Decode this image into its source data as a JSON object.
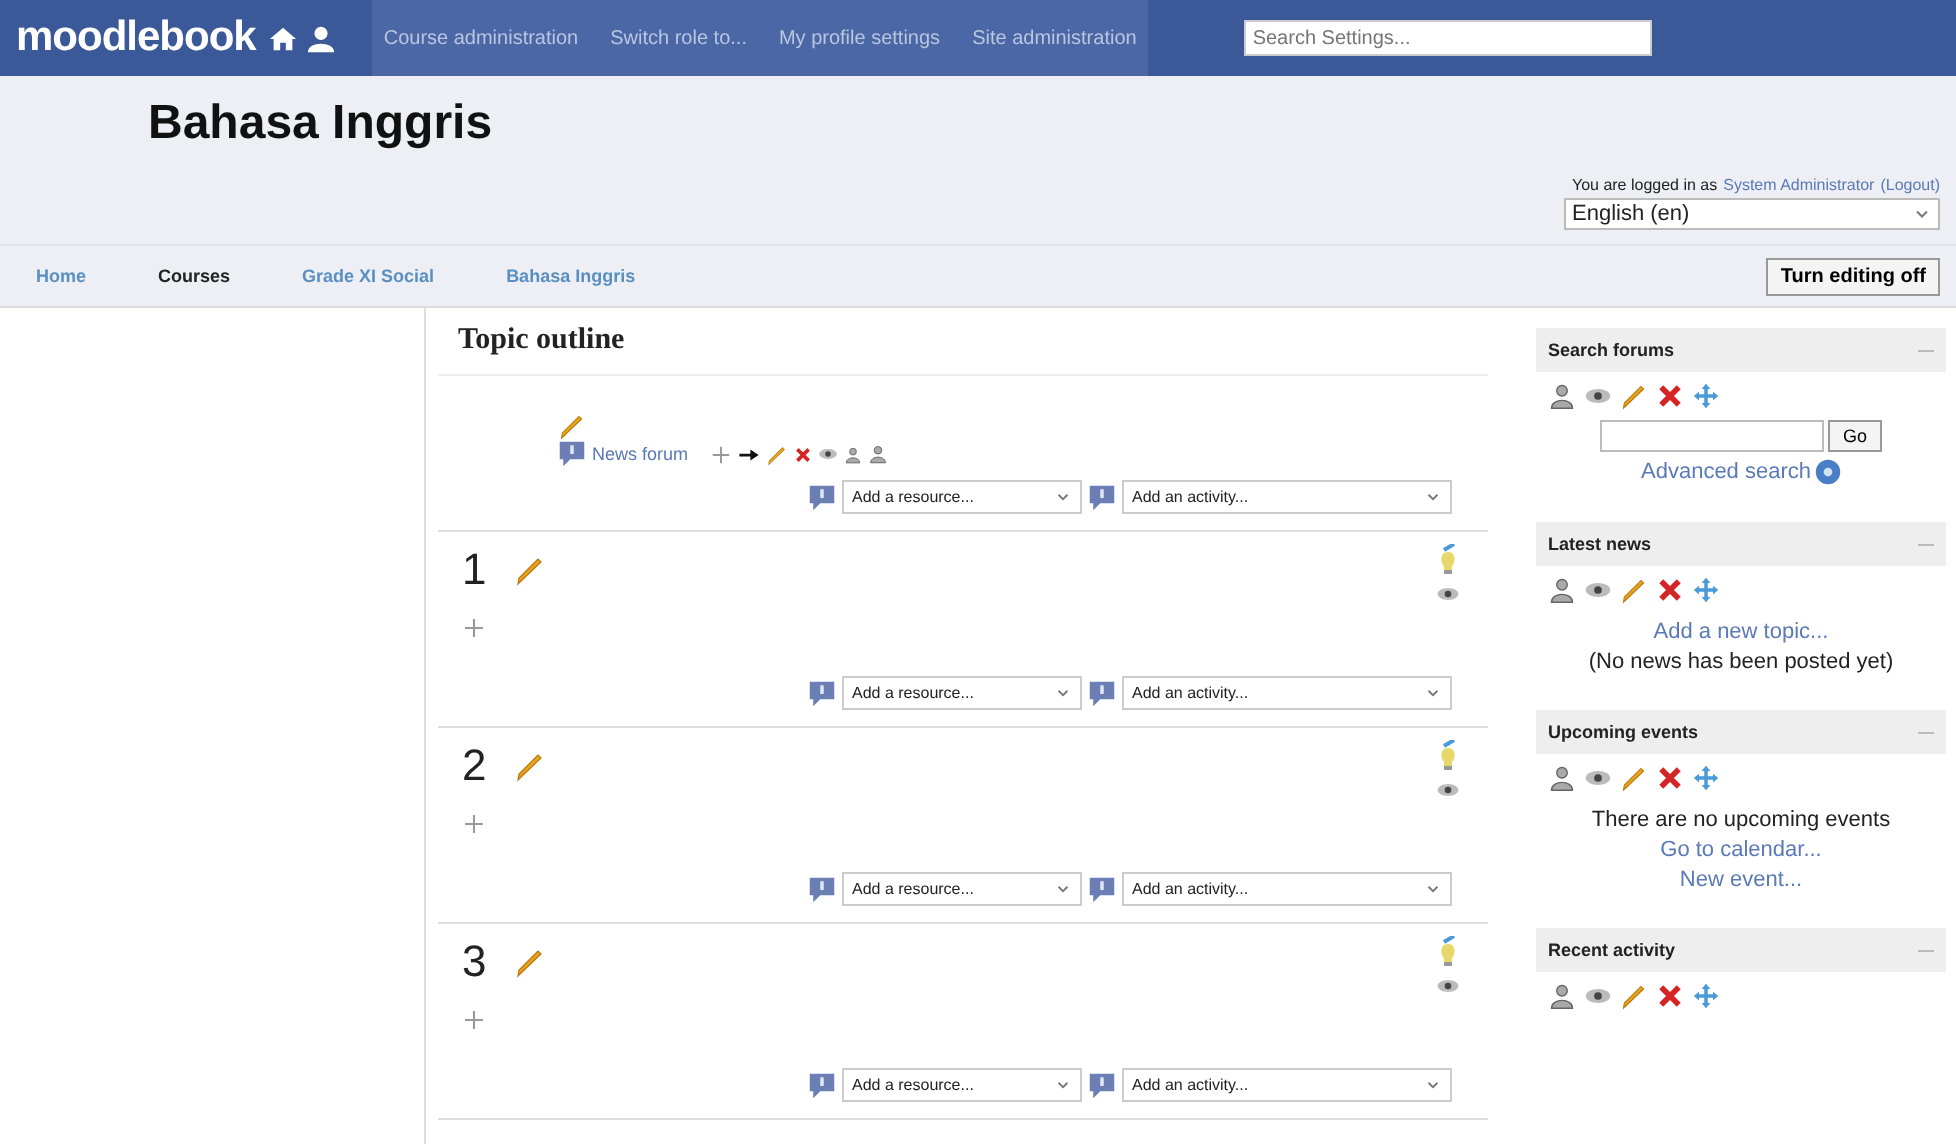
{
  "header": {
    "logo": "moodlebook",
    "menu": [
      "Course administration",
      "Switch role to...",
      "My profile settings",
      "Site administration"
    ],
    "search": {
      "placeholder": "Search Settings..."
    }
  },
  "page": {
    "title": "Bahasa Inggris",
    "login": {
      "text": "You are logged in as",
      "user": "System Administrator",
      "logout": "(Logout)"
    },
    "language": "English (en)",
    "breadcrumbs": [
      {
        "label": "Home",
        "link": true
      },
      {
        "label": "Courses",
        "link": false
      },
      {
        "label": "Grade XI Social",
        "link": true
      },
      {
        "label": "Bahasa Inggris",
        "link": true
      }
    ],
    "edit_button": "Turn editing off"
  },
  "topic_outline": {
    "title": "Topic outline",
    "intro": {
      "forum": "News forum",
      "add_resource": "Add a resource...",
      "add_activity": "Add an activity..."
    },
    "sections": [
      {
        "number": "1",
        "add_resource": "Add a resource...",
        "add_activity": "Add an activity..."
      },
      {
        "number": "2",
        "add_resource": "Add a resource...",
        "add_activity": "Add an activity..."
      },
      {
        "number": "3",
        "add_resource": "Add a resource...",
        "add_activity": "Add an activity..."
      }
    ]
  },
  "blocks": [
    {
      "title": "Search forums",
      "items": [
        {
          "kind": "search",
          "button": "Go"
        },
        {
          "kind": "help_link",
          "text": "Advanced search"
        }
      ]
    },
    {
      "title": "Latest news",
      "items": [
        {
          "kind": "link",
          "text": "Add a new topic..."
        },
        {
          "kind": "text",
          "text": "(No news has been posted yet)"
        }
      ]
    },
    {
      "title": "Upcoming events",
      "items": [
        {
          "kind": "text",
          "text": "There are no upcoming events"
        },
        {
          "kind": "link",
          "text": "Go to calendar..."
        },
        {
          "kind": "link",
          "text": "New event..."
        }
      ]
    },
    {
      "title": "Recent activity"
    }
  ]
}
